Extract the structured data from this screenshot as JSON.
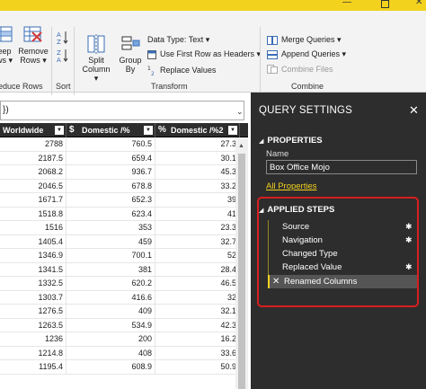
{
  "ribbon": {
    "keep_rows": [
      "eep",
      "ws ▾"
    ],
    "remove_rows": [
      "Remove",
      "Rows ▾"
    ],
    "reduce_rows_label": "educe Rows",
    "sort_label": "Sort",
    "split_column": [
      "Split",
      "Column ▾"
    ],
    "group_by": [
      "Group",
      "By"
    ],
    "data_type": "Data Type: Text ▾",
    "use_first_row": "Use First Row as Headers ▾",
    "replace_values": "Replace Values",
    "transform_label": "Transform",
    "merge_queries": "Merge Queries ▾",
    "append_queries": "Append Queries ▾",
    "combine_files": "Combine Files",
    "combine_label": "Combine"
  },
  "formula": {
    "text": "})"
  },
  "grid": {
    "columns": [
      {
        "label": "Worldwide",
        "type_icon": ""
      },
      {
        "label": "Domestic /%",
        "type_icon": "$"
      },
      {
        "label": "Domestic /%2",
        "type_icon": "%"
      }
    ],
    "rows": [
      [
        "2788",
        "760.5",
        "27.3"
      ],
      [
        "2187.5",
        "659.4",
        "30.1"
      ],
      [
        "2068.2",
        "936.7",
        "45.3"
      ],
      [
        "2046.5",
        "678.8",
        "33.2"
      ],
      [
        "1671.7",
        "652.3",
        "39"
      ],
      [
        "1518.8",
        "623.4",
        "41"
      ],
      [
        "1516",
        "353",
        "23.3"
      ],
      [
        "1405.4",
        "459",
        "32.7"
      ],
      [
        "1346.9",
        "700.1",
        "52"
      ],
      [
        "1341.5",
        "381",
        "28.4"
      ],
      [
        "1332.5",
        "620.2",
        "46.5"
      ],
      [
        "1303.7",
        "416.6",
        "32"
      ],
      [
        "1276.5",
        "409",
        "32.1"
      ],
      [
        "1263.5",
        "534.9",
        "42.3"
      ],
      [
        "1236",
        "200",
        "16.2"
      ],
      [
        "1214.8",
        "408",
        "33.6"
      ],
      [
        "1195.4",
        "608.9",
        "50.9"
      ]
    ]
  },
  "pane": {
    "title": "QUERY SETTINGS",
    "properties_label": "PROPERTIES",
    "name_label": "Name",
    "name_value": "Box Office Mojo",
    "all_properties": "All Properties",
    "applied_steps_label": "APPLIED STEPS",
    "steps": [
      "Source",
      "Navigation",
      "Changed Type",
      "Replaced Value",
      "Renamed Columns"
    ]
  }
}
